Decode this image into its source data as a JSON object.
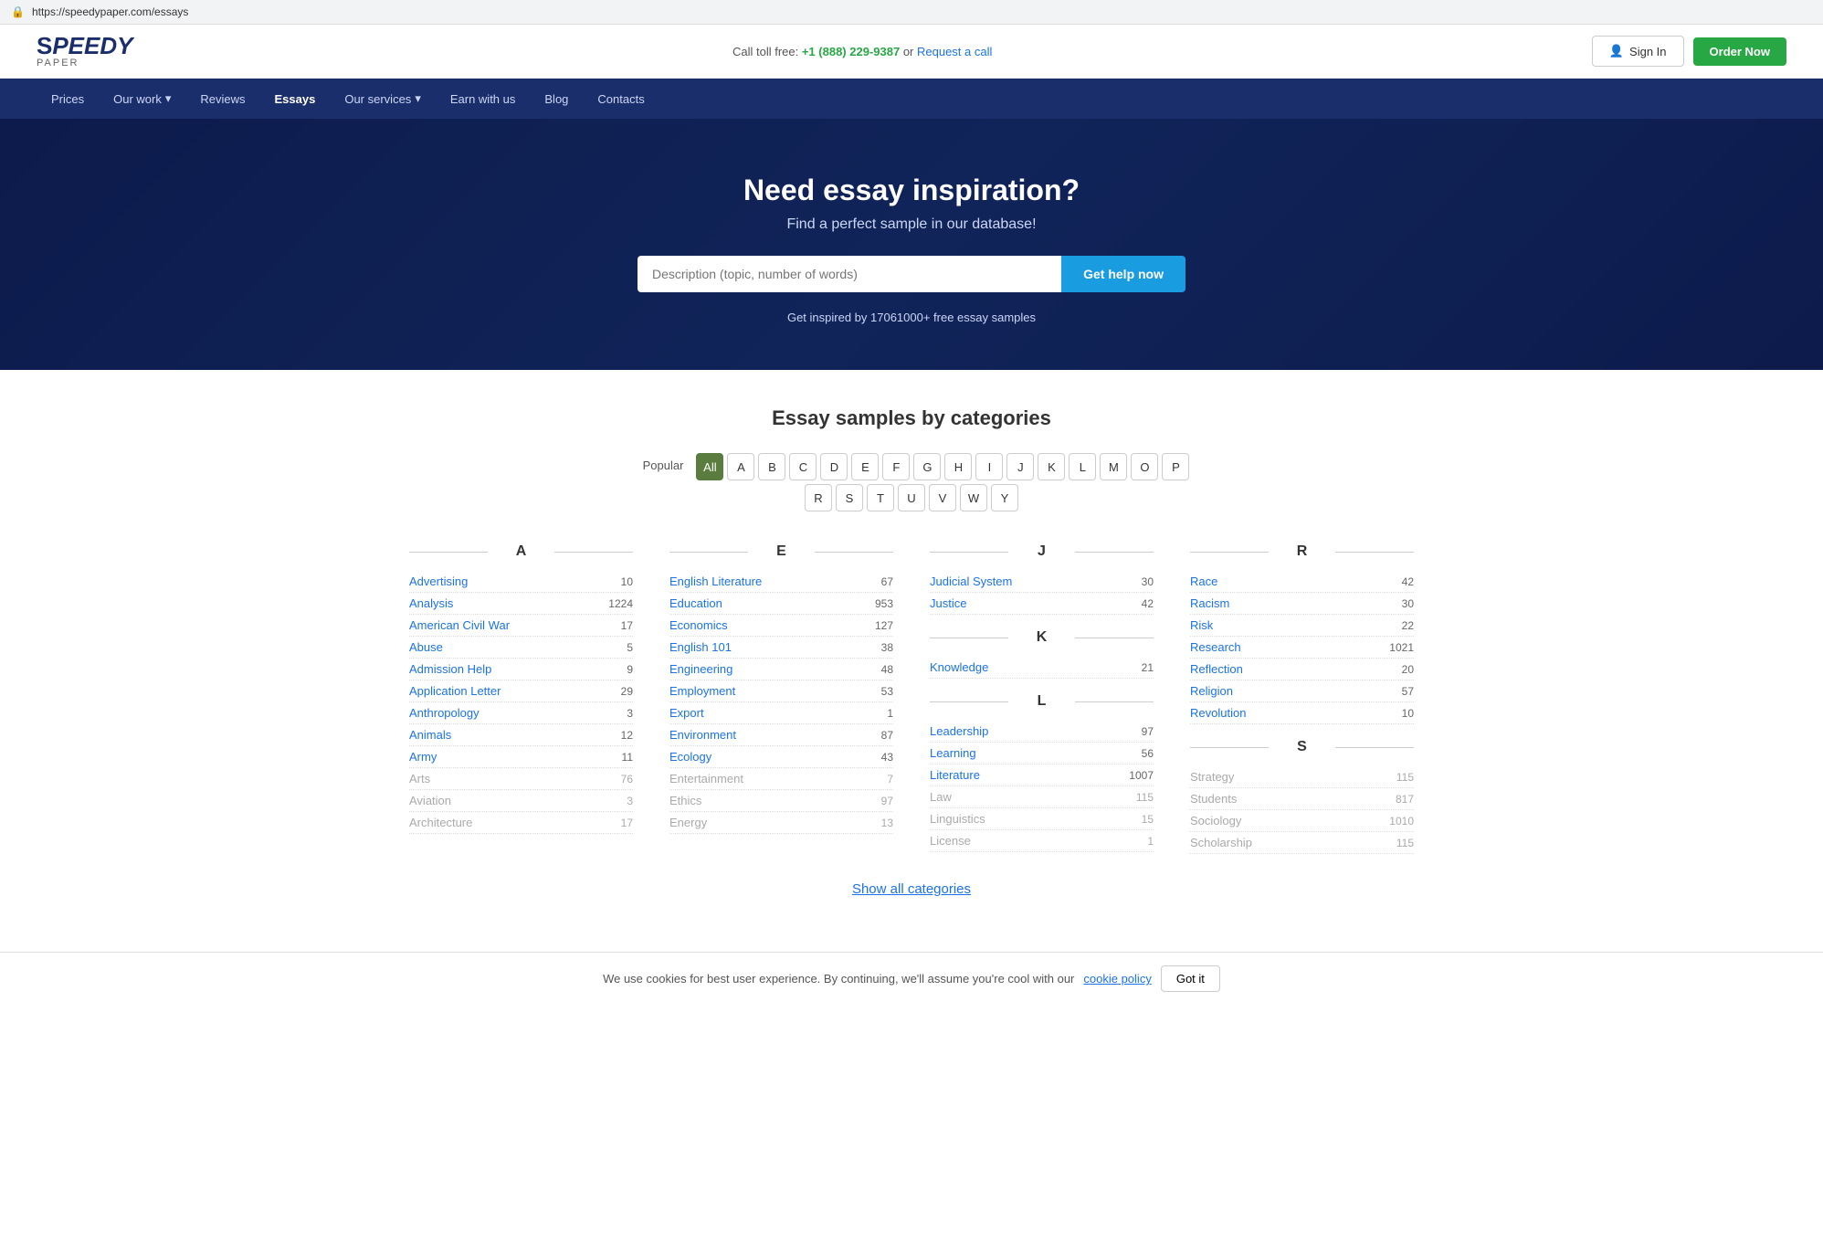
{
  "browser": {
    "url": "https://speedypaper.com/essays"
  },
  "header": {
    "logo_s": "S",
    "logo_peedy": "PEEDY",
    "logo_paper": "paper",
    "call_label": "Call toll free:",
    "phone": "+1 (888) 229-9387",
    "or": "or",
    "request_call": "Request a call",
    "signin_label": "Sign In",
    "order_label": "Order Now"
  },
  "nav": {
    "items": [
      {
        "label": "Prices",
        "active": false
      },
      {
        "label": "Our work",
        "active": false,
        "dropdown": true
      },
      {
        "label": "Reviews",
        "active": false
      },
      {
        "label": "Essays",
        "active": true
      },
      {
        "label": "Our services",
        "active": false,
        "dropdown": true
      },
      {
        "label": "Earn with us",
        "active": false
      },
      {
        "label": "Blog",
        "active": false
      },
      {
        "label": "Contacts",
        "active": false
      }
    ]
  },
  "hero": {
    "title": "Need essay inspiration?",
    "subtitle": "Find a perfect sample in our database!",
    "search_placeholder": "Description (topic, number of words)",
    "search_button": "Get help now",
    "note": "Get inspired by 17061000+ free essay samples"
  },
  "categories": {
    "title": "Essay samples by categories",
    "filter_label": "Popular",
    "letters": [
      "All",
      "A",
      "B",
      "C",
      "D",
      "E",
      "F",
      "G",
      "H",
      "I",
      "J",
      "K",
      "L",
      "M",
      "O",
      "P",
      "R",
      "S",
      "T",
      "U",
      "V",
      "W",
      "Y"
    ],
    "active_letter": "All",
    "columns": [
      {
        "heading": "A",
        "items": [
          {
            "label": "Advertising",
            "count": "10",
            "enabled": true
          },
          {
            "label": "Analysis",
            "count": "1224",
            "enabled": true
          },
          {
            "label": "American Civil War",
            "count": "17",
            "enabled": true
          },
          {
            "label": "Abuse",
            "count": "5",
            "enabled": true
          },
          {
            "label": "Admission Help",
            "count": "9",
            "enabled": true
          },
          {
            "label": "Application Letter",
            "count": "29",
            "enabled": true
          },
          {
            "label": "Anthropology",
            "count": "3",
            "enabled": true
          },
          {
            "label": "Animals",
            "count": "12",
            "enabled": true
          },
          {
            "label": "Army",
            "count": "11",
            "enabled": true
          },
          {
            "label": "Arts",
            "count": "76",
            "enabled": false
          },
          {
            "label": "Aviation",
            "count": "3",
            "enabled": false
          },
          {
            "label": "Architecture",
            "count": "17",
            "enabled": false
          }
        ]
      },
      {
        "heading": "E",
        "items": [
          {
            "label": "English Literature",
            "count": "67",
            "enabled": true
          },
          {
            "label": "Education",
            "count": "953",
            "enabled": true
          },
          {
            "label": "Economics",
            "count": "127",
            "enabled": true
          },
          {
            "label": "English 101",
            "count": "38",
            "enabled": true
          },
          {
            "label": "Engineering",
            "count": "48",
            "enabled": true
          },
          {
            "label": "Employment",
            "count": "53",
            "enabled": true
          },
          {
            "label": "Export",
            "count": "1",
            "enabled": true
          },
          {
            "label": "Environment",
            "count": "87",
            "enabled": true
          },
          {
            "label": "Ecology",
            "count": "43",
            "enabled": true
          },
          {
            "label": "Entertainment",
            "count": "7",
            "enabled": false
          },
          {
            "label": "Ethics",
            "count": "97",
            "enabled": false
          },
          {
            "label": "Energy",
            "count": "13",
            "enabled": false
          }
        ]
      },
      {
        "heading": "J",
        "items": [
          {
            "label": "Judicial System",
            "count": "30",
            "enabled": true
          },
          {
            "label": "Justice",
            "count": "42",
            "enabled": true
          }
        ],
        "sub_sections": [
          {
            "heading": "K",
            "items": [
              {
                "label": "Knowledge",
                "count": "21",
                "enabled": true
              }
            ]
          },
          {
            "heading": "L",
            "items": [
              {
                "label": "Leadership",
                "count": "97",
                "enabled": true
              },
              {
                "label": "Learning",
                "count": "56",
                "enabled": true
              },
              {
                "label": "Literature",
                "count": "1007",
                "enabled": true
              },
              {
                "label": "Law",
                "count": "115",
                "enabled": false
              },
              {
                "label": "Linguistics",
                "count": "15",
                "enabled": false
              },
              {
                "label": "License",
                "count": "1",
                "enabled": false
              }
            ]
          }
        ]
      },
      {
        "heading": "R",
        "items": [
          {
            "label": "Race",
            "count": "42",
            "enabled": true
          },
          {
            "label": "Racism",
            "count": "30",
            "enabled": true
          },
          {
            "label": "Risk",
            "count": "22",
            "enabled": true
          },
          {
            "label": "Research",
            "count": "1021",
            "enabled": true
          },
          {
            "label": "Reflection",
            "count": "20",
            "enabled": true
          },
          {
            "label": "Religion",
            "count": "57",
            "enabled": true
          },
          {
            "label": "Revolution",
            "count": "10",
            "enabled": true
          }
        ],
        "sub_sections": [
          {
            "heading": "S",
            "items": [
              {
                "label": "Strategy",
                "count": "115",
                "enabled": false
              },
              {
                "label": "Students",
                "count": "817",
                "enabled": false
              },
              {
                "label": "Sociology",
                "count": "1010",
                "enabled": false
              },
              {
                "label": "Scholarship",
                "count": "115",
                "enabled": false
              }
            ]
          }
        ]
      }
    ],
    "show_all": "Show all categories"
  },
  "cookie": {
    "text": "We use cookies for best user experience. By continuing, we'll assume you're cool with our",
    "link": "cookie policy",
    "button": "Got it"
  }
}
